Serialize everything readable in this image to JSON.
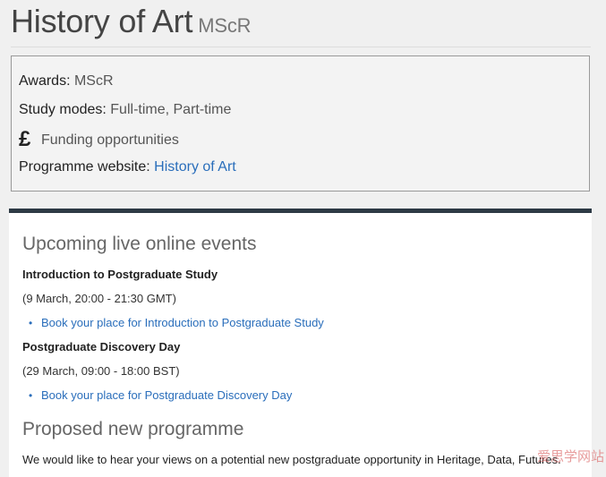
{
  "header": {
    "title": "History of Art",
    "award": "MScR"
  },
  "info": {
    "awards_label": "Awards:",
    "awards_value": "MScR",
    "study_modes_label": "Study modes:",
    "study_modes_value": "Full-time, Part-time",
    "funding_icon": "£",
    "funding_label": "Funding opportunities",
    "website_label": "Programme website:",
    "website_link": "History of Art"
  },
  "events": {
    "heading": "Upcoming live online events",
    "items": [
      {
        "title": "Introduction to Postgraduate Study",
        "date": "(9 March, 20:00 - 21:30 GMT)",
        "link": "Book your place for Introduction to Postgraduate Study"
      },
      {
        "title": "Postgraduate Discovery Day",
        "date": "(29 March, 09:00 - 18:00 BST)",
        "link": "Book your place for Postgraduate Discovery Day"
      }
    ]
  },
  "proposed": {
    "heading": "Proposed new programme",
    "text": "We would like to hear your views on a potential new postgraduate opportunity in Heritage, Data, Futures."
  },
  "watermark": "爱思学网站"
}
